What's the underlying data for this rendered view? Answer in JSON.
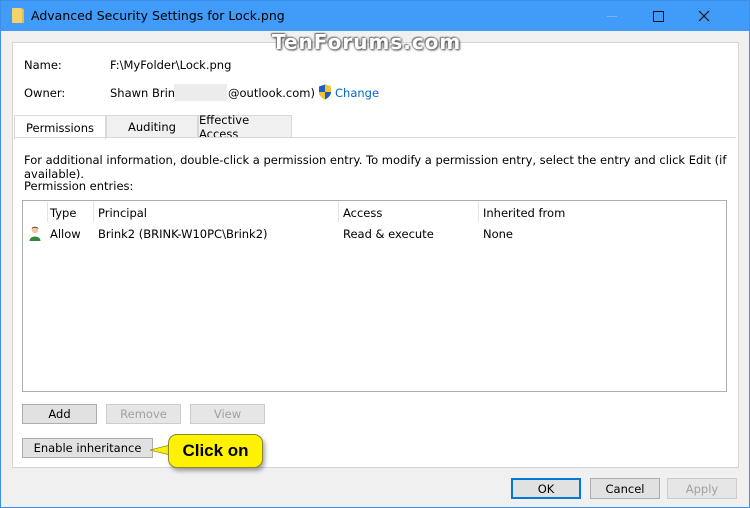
{
  "window": {
    "title": "Advanced Security Settings for Lock.png",
    "controls": {
      "minimize": "minimize",
      "maximize": "maximize",
      "close": "close"
    },
    "title_bar_color": "#419bf9"
  },
  "watermark": "TenForums.com",
  "details": {
    "name_label": "Name:",
    "name_value": "F:\\MyFolder\\Lock.png",
    "owner_label": "Owner:",
    "owner_value": "Shawn Brink",
    "owner_domain": "@outlook.com)",
    "change_label": "Change",
    "link_color": "#0066cc"
  },
  "tabs": [
    {
      "label": "Permissions",
      "active": true
    },
    {
      "label": "Auditing",
      "active": false
    },
    {
      "label": "Effective Access",
      "active": false
    }
  ],
  "permissions": {
    "info_text": "For additional information, double-click a permission entry. To modify a permission entry, select the entry and click Edit (if available).",
    "entries_label": "Permission entries:",
    "columns": [
      "Type",
      "Principal",
      "Access",
      "Inherited from"
    ],
    "rows": [
      {
        "icon": "user-icon",
        "type": "Allow",
        "principal": "Brink2 (BRINK-W10PC\\Brink2)",
        "access": "Read & execute",
        "inherited_from": "None"
      }
    ]
  },
  "buttons": {
    "add": "Add",
    "remove": "Remove",
    "view": "View",
    "enable_inheritance": "Enable inheritance",
    "ok": "OK",
    "cancel": "Cancel",
    "apply": "Apply"
  },
  "callout": {
    "text": "Click on",
    "color": "#fff200"
  }
}
